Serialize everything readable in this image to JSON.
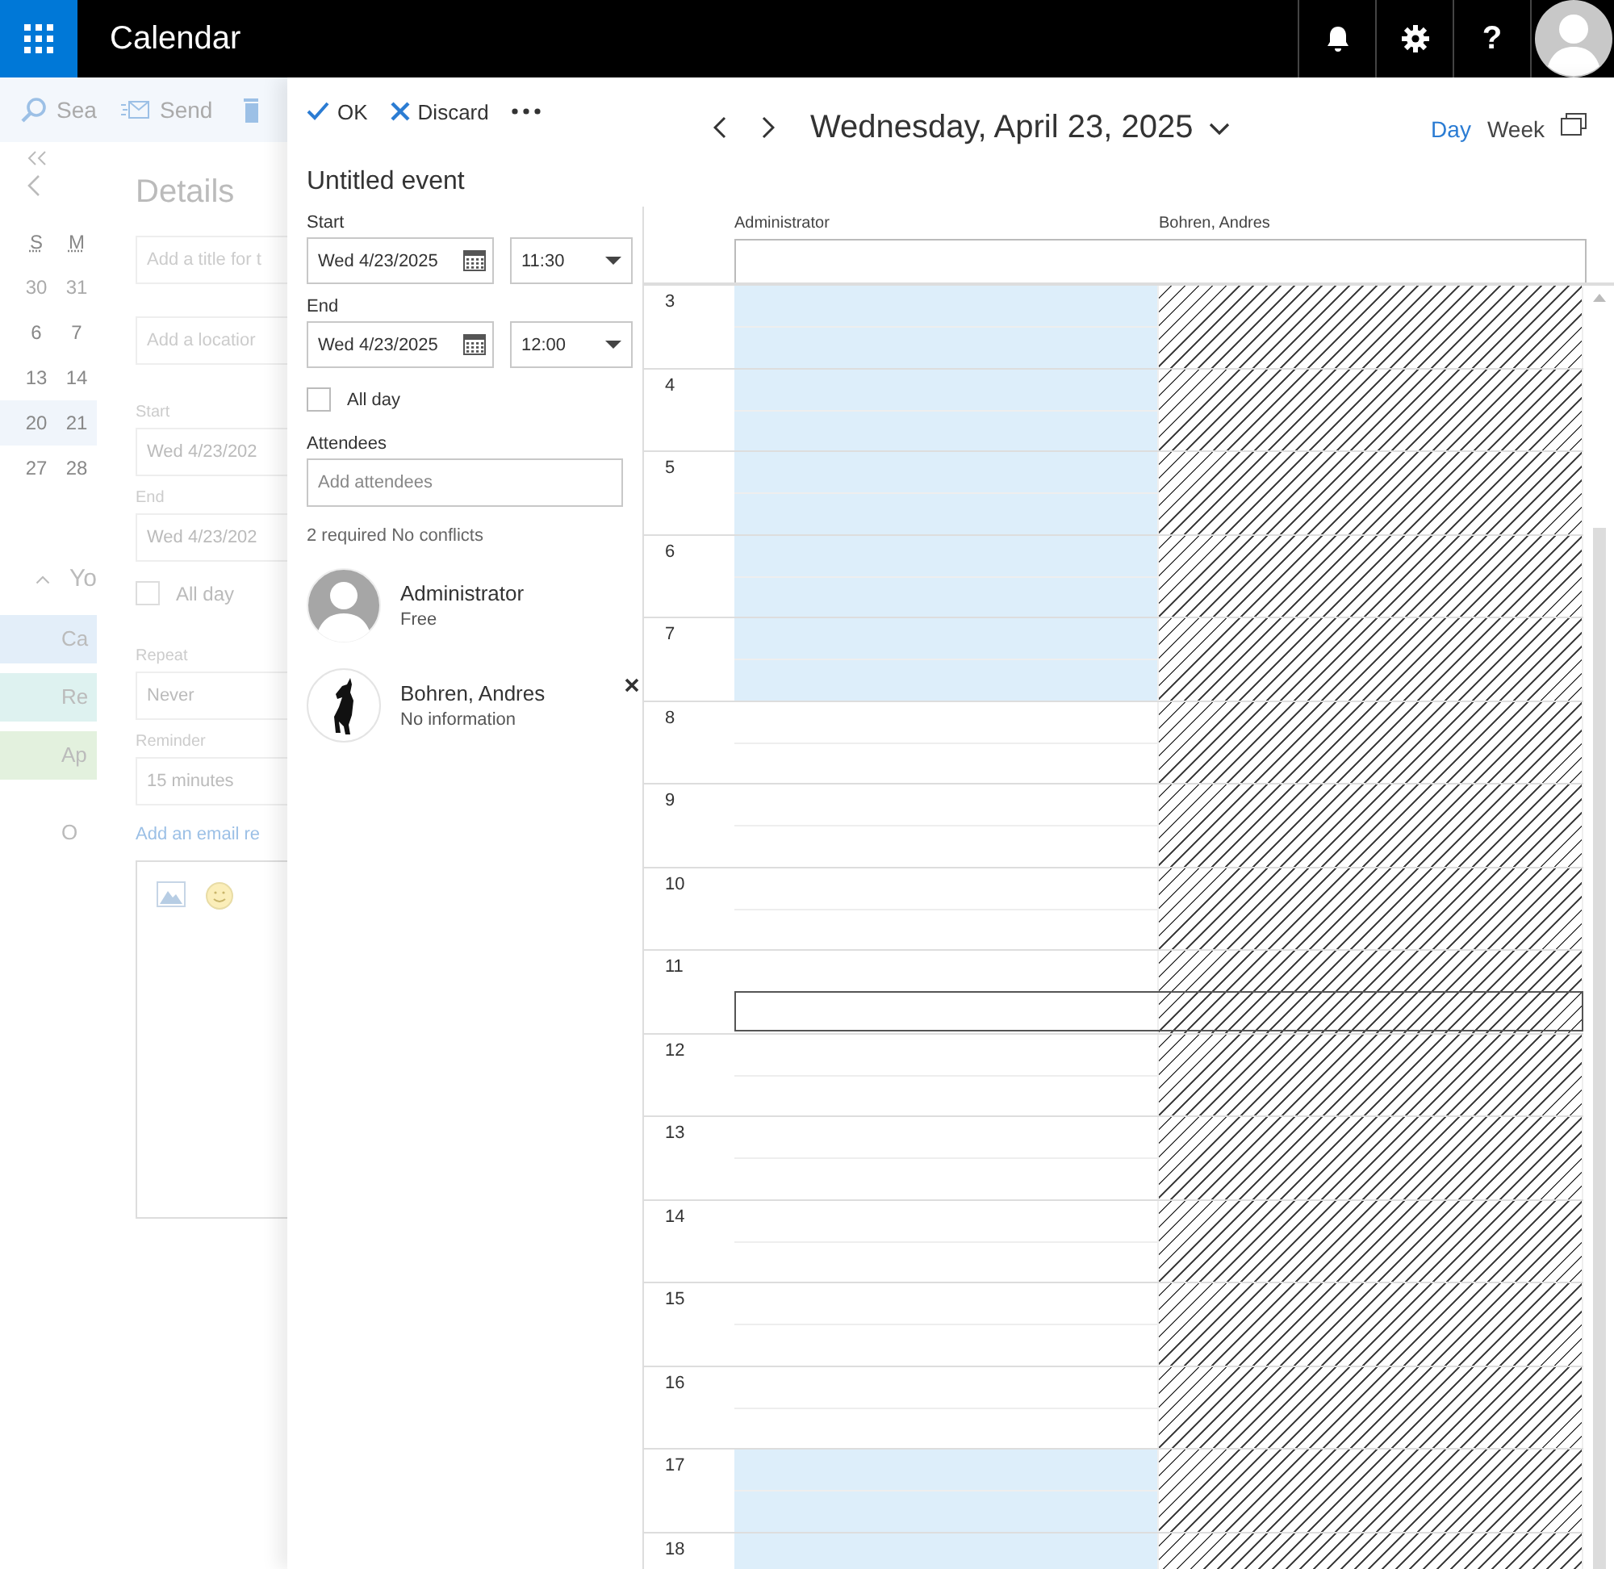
{
  "app_bar": {
    "title": "Calendar",
    "help_label": "?"
  },
  "background": {
    "command_bar": [
      {
        "kind": "search",
        "label": "Sea"
      },
      {
        "kind": "send",
        "label": "Send"
      },
      {
        "kind": "delete"
      }
    ],
    "mini_calendar": {
      "weekdays": [
        "S",
        "M"
      ],
      "weeks": [
        {
          "days": [
            "30",
            "31"
          ],
          "outside_month": true,
          "selected": false
        },
        {
          "days": [
            "6",
            "7"
          ],
          "outside_month": false,
          "selected": false
        },
        {
          "days": [
            "13",
            "14"
          ],
          "outside_month": false,
          "selected": false
        },
        {
          "days": [
            "20",
            "21"
          ],
          "outside_month": false,
          "selected": true
        },
        {
          "days": [
            "27",
            "28"
          ],
          "outside_month": false,
          "selected": false
        }
      ]
    },
    "calendars_heading": "Yo",
    "calendars": [
      {
        "label": "Ca",
        "color": "#e3eef9"
      },
      {
        "label": "Re",
        "color": "#def2f0"
      },
      {
        "label": "Ap",
        "color": "#e3f1de"
      },
      {
        "label": "O"
      }
    ],
    "details": {
      "title": "Details",
      "title_placeholder": "Add a title for t",
      "location_placeholder": "Add a locatior",
      "start_label": "Start",
      "start_date": "Wed 4/23/202",
      "end_label": "End",
      "end_date": "Wed 4/23/202",
      "all_day": {
        "label": "All day",
        "checked": false
      },
      "repeat_label": "Repeat",
      "repeat": "Never",
      "reminder_label": "Reminder",
      "reminder": "15 minutes",
      "email_link": "Add an email re"
    }
  },
  "event_form": {
    "toolbar": [
      {
        "kind": "confirm",
        "label": "OK"
      },
      {
        "kind": "discard",
        "label": "Discard"
      },
      {
        "kind": "more"
      }
    ],
    "title": "Untitled event",
    "start": {
      "label": "Start",
      "date": "Wed 4/23/2025",
      "time": "11:30"
    },
    "end": {
      "label": "End",
      "date": "Wed 4/23/2025",
      "time": "12:00"
    },
    "all_day": {
      "label": "All day",
      "checked": false
    },
    "attendees_label": "Attendees",
    "attendees_placeholder": "Add attendees",
    "summary": "2 required No conflicts",
    "attendees": [
      {
        "name": "Administrator",
        "status": "Free",
        "kind": "default",
        "removable": false
      },
      {
        "name": "Bohren, Andres",
        "status": "No information",
        "kind": "picture",
        "removable": true
      }
    ]
  },
  "scheduler": {
    "date": "Wednesday, April 23, 2025",
    "views": [
      {
        "label": "Day",
        "selected": true
      },
      {
        "label": "Week",
        "selected": false
      }
    ],
    "columns": [
      {
        "name": "Administrator",
        "kind": "free_busy"
      },
      {
        "name": "Bohren, Andres",
        "kind": "no_information"
      }
    ],
    "rows": [
      {
        "hour": "3",
        "off_hours": true,
        "selected": false
      },
      {
        "hour": "4",
        "off_hours": true,
        "selected": false
      },
      {
        "hour": "5",
        "off_hours": true,
        "selected": false
      },
      {
        "hour": "6",
        "off_hours": true,
        "selected": false
      },
      {
        "hour": "7",
        "off_hours": true,
        "selected": false
      },
      {
        "hour": "8",
        "off_hours": false,
        "selected": false
      },
      {
        "hour": "9",
        "off_hours": false,
        "selected": false
      },
      {
        "hour": "10",
        "off_hours": false,
        "selected": false
      },
      {
        "hour": "11",
        "off_hours": false,
        "selected": true
      },
      {
        "hour": "12",
        "off_hours": false,
        "selected": false
      },
      {
        "hour": "13",
        "off_hours": false,
        "selected": false
      },
      {
        "hour": "14",
        "off_hours": false,
        "selected": false
      },
      {
        "hour": "15",
        "off_hours": false,
        "selected": false
      },
      {
        "hour": "16",
        "off_hours": false,
        "selected": false
      },
      {
        "hour": "17",
        "off_hours": true,
        "selected": false
      },
      {
        "hour": "18",
        "off_hours": true,
        "selected": false
      }
    ]
  }
}
